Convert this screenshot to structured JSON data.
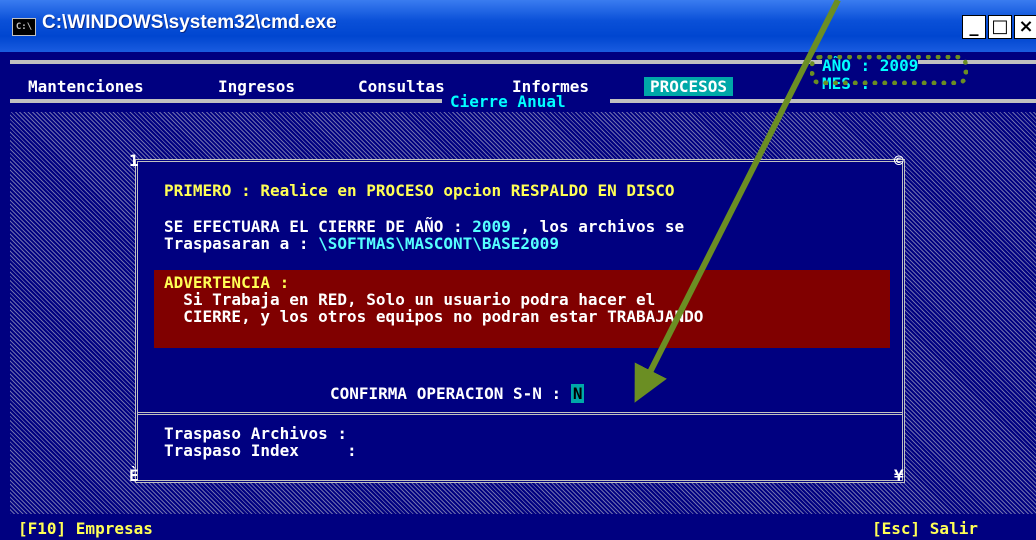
{
  "window": {
    "title": "C:\\WINDOWS\\system32\\cmd.exe",
    "icon": "cmd-icon",
    "minimize_label": "_",
    "maximize_label": "□",
    "close_label": "×"
  },
  "menu": {
    "items": [
      "Mantenciones",
      "Ingresos",
      "Consultas",
      "Informes"
    ],
    "active": "PROCESOS"
  },
  "header": {
    "year_label": "AÑO : 2009",
    "month_label": "MES :",
    "section_title": "Cierre Anual"
  },
  "dialog": {
    "step_text": "PRIMERO : Realice en PROCESO opcion RESPALDO EN DISCO",
    "close_line_prefix": "SE EFECTUARA EL CIERRE DE AÑO : ",
    "close_year": "2009",
    "close_line_suffix": " , los archivos se",
    "transfer_prefix": "Traspasaran a : ",
    "transfer_path": "\\SOFTMAS\\MASCONT\\BASE2009",
    "warning_title": "ADVERTENCIA :",
    "warning_line1": "  Si Trabaja en RED, Solo un usuario podra hacer el",
    "warning_line2": "  CIERRE, y los otros equipos no podran estar TRABAJANDO",
    "confirm_label": "CONFIRMA OPERACION S-N : ",
    "confirm_value": "N",
    "transfer_files_label": "Traspaso Archivos :",
    "transfer_index_label": "Traspaso Index     :",
    "corner_tl": "1",
    "corner_tr": "©",
    "corner_bl": "È",
    "corner_br": "¥"
  },
  "status": {
    "left": "[F10] Empresas",
    "right": "[Esc] Salir"
  },
  "colors": {
    "console_bg": "#000080",
    "accent_yellow": "#ffff55",
    "accent_cyan": "#55ffff",
    "warning_bg": "#800000",
    "annotation": "#6b8e23"
  }
}
